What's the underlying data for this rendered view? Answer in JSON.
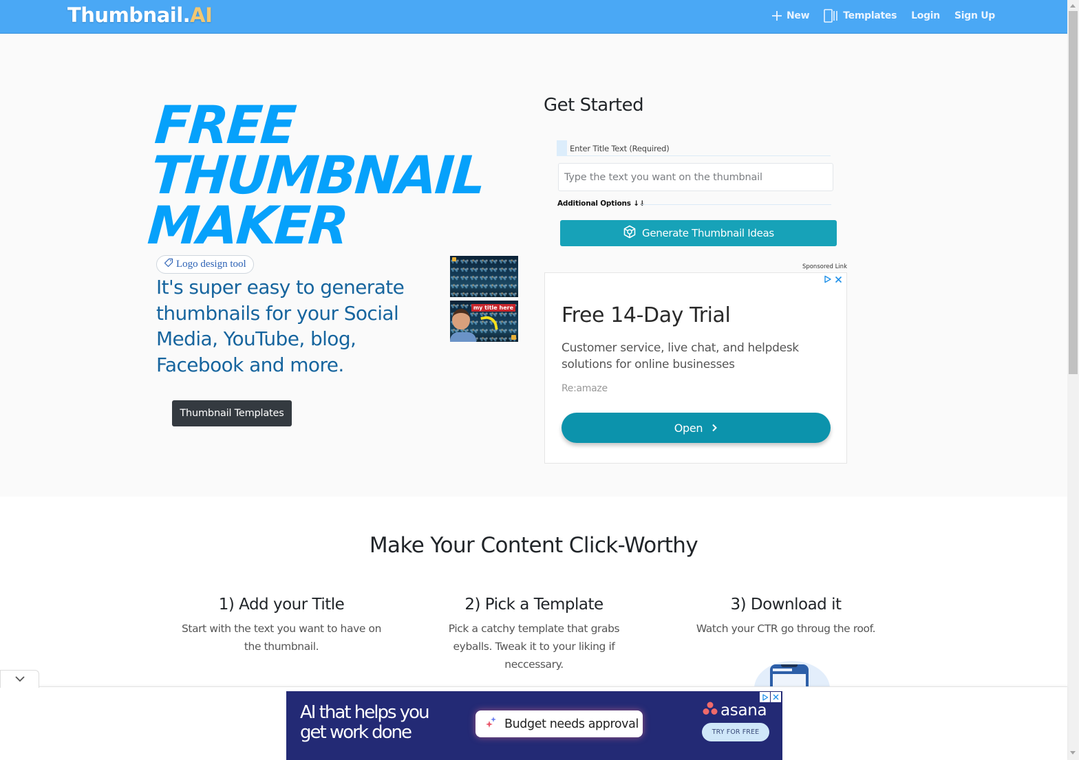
{
  "navbar": {
    "brand_main": "Thumbnail.",
    "brand_accent": "AI",
    "links": [
      {
        "label": "New",
        "icon": "plus-icon"
      },
      {
        "label": "Templates",
        "icon": "templates-icon"
      },
      {
        "label": "Login"
      },
      {
        "label": "Sign Up"
      }
    ]
  },
  "hero": {
    "title_lines": [
      "FREE",
      "THUMBNAIL",
      "MAKER"
    ],
    "logo_tag": "Logo design tool",
    "subtitle": "It's super easy to generate thumbnails for your Social Media, YouTube, blog, Facebook and more.",
    "templates_button": "Thumbnail Templates",
    "sample_thumb_title": "my title here"
  },
  "get_started": {
    "title": "Get Started",
    "field_label": "Enter Title Text (Required)",
    "input_value": "",
    "input_placeholder": "Type the text you want on the thumbnail",
    "additional_options": "Additional Options ↓↓",
    "generate_button": "Generate Thumbnail Ideas"
  },
  "ad": {
    "sponsored_label": "Sponsored Link",
    "title": "Free 14-Day Trial",
    "description": "Customer service, live chat, and helpdesk solutions for online businesses",
    "advertiser": "Re:amaze",
    "cta": "Open"
  },
  "features": {
    "section_title": "Make Your Content Click-Worthy",
    "items": [
      {
        "title": "1) Add your Title",
        "text": "Start with the text you want to have on the thumbnail."
      },
      {
        "title": "2) Pick a Template",
        "text": "Pick a catchy template that grabs eyballs. Tweak it to your liking if neccessary."
      },
      {
        "title": "3) Download it",
        "text": "Watch your CTR go throug the roof."
      }
    ]
  },
  "bottom_ad": {
    "headline_line1": "AI that helps you",
    "headline_line2": "get work done",
    "pill_text": "Budget needs approval",
    "brand": "asana",
    "cta": "TRY FOR FREE"
  },
  "colors": {
    "navbar": "#4aa8f5",
    "brand_accent": "#f2c772",
    "hero_title": "#06a1fb",
    "hero_subtitle": "#17659e",
    "generate_button": "#17a2b8",
    "ad_button": "#0c93ac",
    "bottom_ad_bg": "#232a75"
  }
}
